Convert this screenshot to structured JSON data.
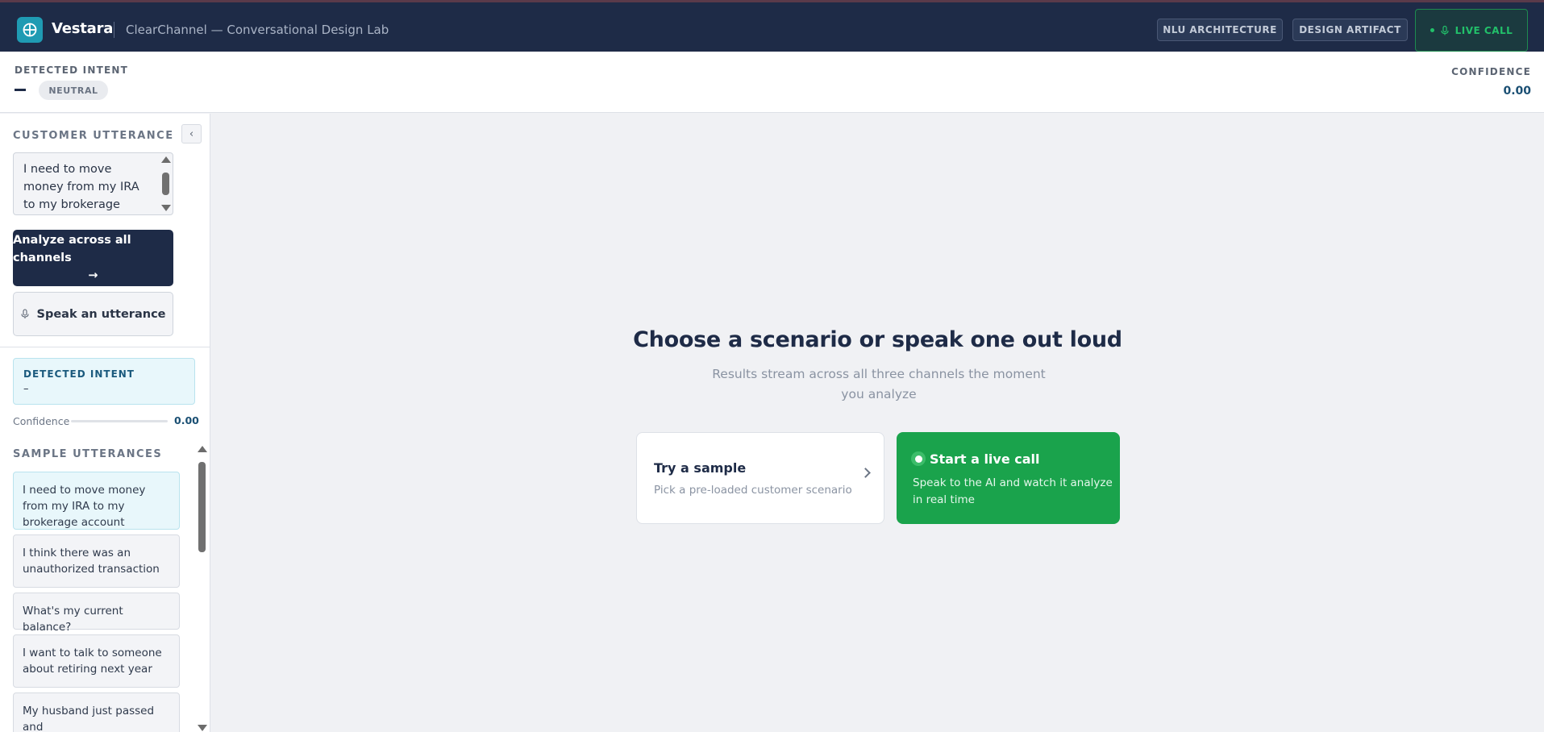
{
  "header": {
    "brand": "Vestara",
    "subtitle": "ClearChannel — Conversational Design Lab",
    "nlu_button": "NLU ARCHITECTURE",
    "design_button": "DESIGN ARTIFACT",
    "live_call_button": "LIVE CALL"
  },
  "intent_bar": {
    "label": "DETECTED INTENT",
    "pill": "NEUTRAL",
    "confidence_label": "CONFIDENCE",
    "confidence_value": "0.00"
  },
  "sidebar": {
    "title": "CUSTOMER UTTERANCE",
    "utterance": "I need to move money from my IRA to my brokerage account",
    "analyze_button": "Analyze across all channels",
    "analyze_arrow": "→",
    "speak_button": "Speak an utterance",
    "detected_intent": {
      "label": "DETECTED INTENT",
      "value": "–"
    },
    "confidence": {
      "label": "Confidence",
      "value": "0.00",
      "fraction": 0
    },
    "samples_title": "SAMPLE UTTERANCES",
    "samples": [
      "I need to move money from my IRA to my brokerage account",
      "I think there was an unauthorized transaction",
      "What's my current balance?",
      "I want to talk to someone about retiring next year",
      "My husband just passed and"
    ]
  },
  "main": {
    "title": "Choose a scenario or speak one out loud",
    "subtitle": "Results stream across all three channels the moment you analyze",
    "sample_card": {
      "title": "Try a sample",
      "subtitle": "Pick a pre-loaded customer scenario"
    },
    "live_card": {
      "title": "Start a live call",
      "subtitle": "Speak to the AI and watch it analyze in real time"
    }
  },
  "colors": {
    "header_bg": "#1e2b47",
    "accent_teal": "#1f9bb3",
    "live_green": "#1aa34c",
    "confidence_blue": "#1a4f73"
  }
}
